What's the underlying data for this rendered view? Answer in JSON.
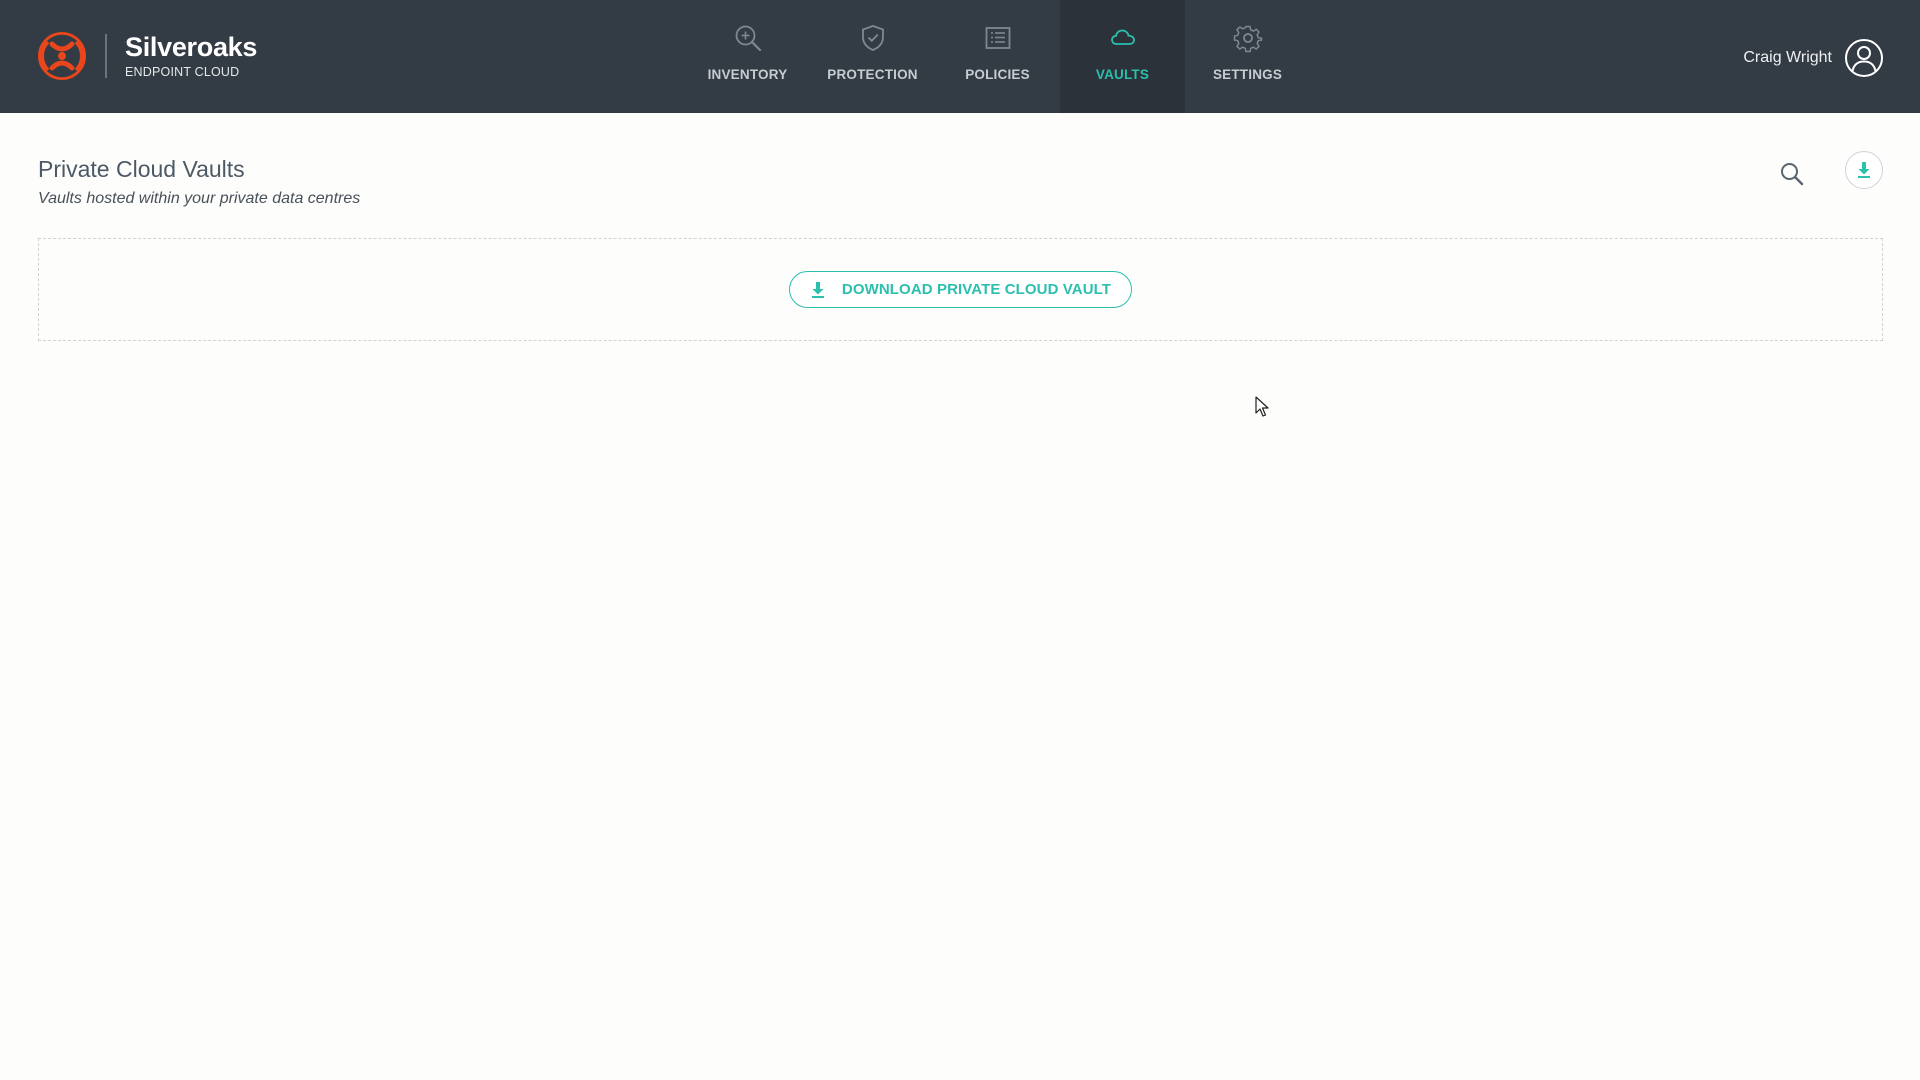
{
  "brand": {
    "name": "Silveroaks",
    "subtitle": "ENDPOINT CLOUD"
  },
  "nav": {
    "items": [
      {
        "label": "INVENTORY",
        "icon": "inventory-search-icon"
      },
      {
        "label": "PROTECTION",
        "icon": "shield-check-icon"
      },
      {
        "label": "POLICIES",
        "icon": "list-document-icon"
      },
      {
        "label": "VAULTS",
        "icon": "cloud-icon",
        "active": true
      },
      {
        "label": "SETTINGS",
        "icon": "gear-icon"
      }
    ]
  },
  "user": {
    "name": "Craig Wright",
    "icon": "user-avatar-icon"
  },
  "page": {
    "title": "Private Cloud Vaults",
    "subtitle": "Vaults hosted within your private data centres"
  },
  "actions": {
    "search_icon": "search-icon",
    "export_icon": "download-icon",
    "download_vault_label": "DOWNLOAD PRIVATE CLOUD VAULT"
  },
  "colors": {
    "topbar": "#333b44",
    "active_nav_bg": "#2b3239",
    "accent": "#2bbfae",
    "logo": "#e8461b"
  }
}
